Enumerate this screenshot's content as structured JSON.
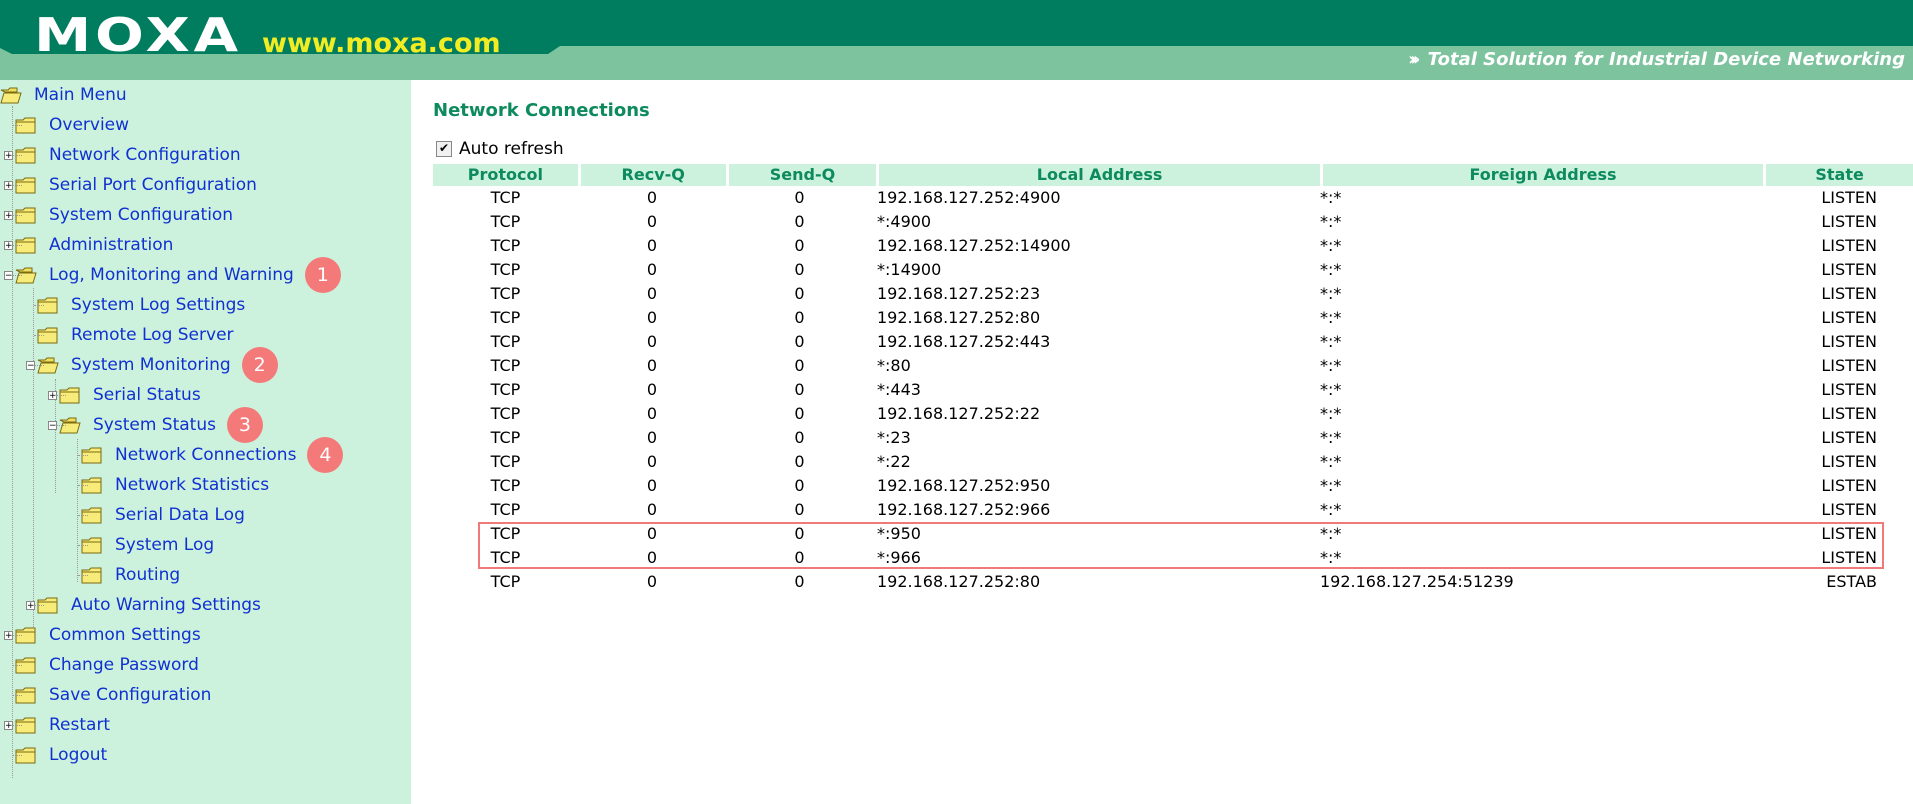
{
  "header": {
    "logo": "MOXA",
    "site": "www.moxa.com",
    "tagline": "Total Solution for Industrial Device Networking",
    "colors": {
      "dark": "#007c5e",
      "light": "#7cc39e",
      "site": "#f2ec22"
    }
  },
  "sidebar": {
    "items": [
      {
        "label": "Main Menu",
        "pm": "",
        "open": true
      },
      {
        "label": "Overview",
        "pm": "",
        "open": false
      },
      {
        "label": "Network Configuration",
        "pm": "+",
        "open": false
      },
      {
        "label": "Serial Port Configuration",
        "pm": "+",
        "open": false
      },
      {
        "label": "System Configuration",
        "pm": "+",
        "open": false
      },
      {
        "label": "Administration",
        "pm": "+",
        "open": false
      },
      {
        "label": "Log, Monitoring and Warning",
        "pm": "−",
        "open": true,
        "badge": "1"
      },
      {
        "label": "System Log Settings",
        "pm": "",
        "open": false
      },
      {
        "label": "Remote Log Server",
        "pm": "",
        "open": false
      },
      {
        "label": "System Monitoring",
        "pm": "−",
        "open": true,
        "badge": "2"
      },
      {
        "label": "Serial Status",
        "pm": "+",
        "open": false
      },
      {
        "label": "System Status",
        "pm": "−",
        "open": true,
        "badge": "3"
      },
      {
        "label": "Network Connections",
        "pm": "",
        "open": false,
        "badge": "4"
      },
      {
        "label": "Network Statistics",
        "pm": "",
        "open": false
      },
      {
        "label": "Serial Data Log",
        "pm": "",
        "open": false
      },
      {
        "label": "System Log",
        "pm": "",
        "open": false
      },
      {
        "label": "Routing",
        "pm": "",
        "open": false
      },
      {
        "label": "Auto Warning Settings",
        "pm": "+",
        "open": false
      },
      {
        "label": "Common Settings",
        "pm": "+",
        "open": false
      },
      {
        "label": "Change Password",
        "pm": "",
        "open": false
      },
      {
        "label": "Save Configuration",
        "pm": "",
        "open": false
      },
      {
        "label": "Restart",
        "pm": "+",
        "open": false
      },
      {
        "label": "Logout",
        "pm": "",
        "open": false
      }
    ]
  },
  "main": {
    "title": "Network Connections",
    "auto_refresh_label": "Auto refresh",
    "auto_refresh_checked": true,
    "columns": [
      "Protocol",
      "Recv-Q",
      "Send-Q",
      "Local Address",
      "Foreign Address",
      "State"
    ],
    "rows": [
      [
        "TCP",
        "0",
        "0",
        "192.168.127.252:4900",
        "*:*",
        "LISTEN"
      ],
      [
        "TCP",
        "0",
        "0",
        "*:4900",
        "*:*",
        "LISTEN"
      ],
      [
        "TCP",
        "0",
        "0",
        "192.168.127.252:14900",
        "*:*",
        "LISTEN"
      ],
      [
        "TCP",
        "0",
        "0",
        "*:14900",
        "*:*",
        "LISTEN"
      ],
      [
        "TCP",
        "0",
        "0",
        "192.168.127.252:23",
        "*:*",
        "LISTEN"
      ],
      [
        "TCP",
        "0",
        "0",
        "192.168.127.252:80",
        "*:*",
        "LISTEN"
      ],
      [
        "TCP",
        "0",
        "0",
        "192.168.127.252:443",
        "*:*",
        "LISTEN"
      ],
      [
        "TCP",
        "0",
        "0",
        "*:80",
        "*:*",
        "LISTEN"
      ],
      [
        "TCP",
        "0",
        "0",
        "*:443",
        "*:*",
        "LISTEN"
      ],
      [
        "TCP",
        "0",
        "0",
        "192.168.127.252:22",
        "*:*",
        "LISTEN"
      ],
      [
        "TCP",
        "0",
        "0",
        "*:23",
        "*:*",
        "LISTEN"
      ],
      [
        "TCP",
        "0",
        "0",
        "*:22",
        "*:*",
        "LISTEN"
      ],
      [
        "TCP",
        "0",
        "0",
        "192.168.127.252:950",
        "*:*",
        "LISTEN"
      ],
      [
        "TCP",
        "0",
        "0",
        "192.168.127.252:966",
        "*:*",
        "LISTEN"
      ],
      [
        "TCP",
        "0",
        "0",
        "*:950",
        "*:*",
        "LISTEN"
      ],
      [
        "TCP",
        "0",
        "0",
        "*:966",
        "*:*",
        "LISTEN"
      ],
      [
        "TCP",
        "0",
        "0",
        "192.168.127.252:80",
        "192.168.127.254:51239",
        "ESTAB"
      ]
    ],
    "highlight_color": "#f07a7a"
  }
}
